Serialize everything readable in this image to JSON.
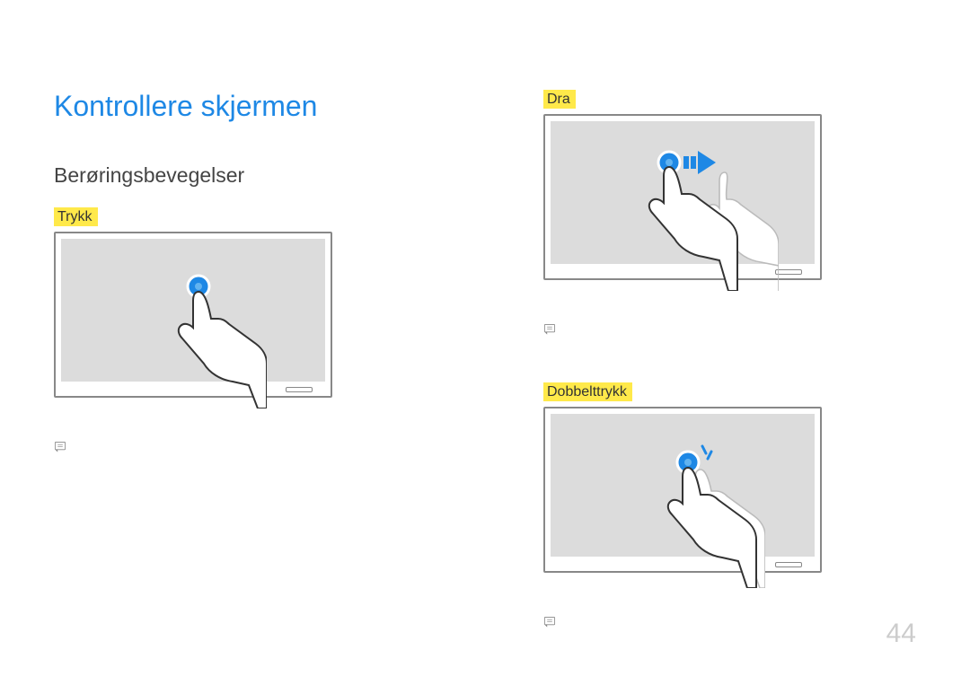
{
  "page_number": "44",
  "title": "Kontrollere skjermen",
  "subtitle": "Berøringsbevegelser",
  "gestures": {
    "tap": {
      "label": "Trykk"
    },
    "drag": {
      "label": "Dra"
    },
    "doubletap": {
      "label": "Dobbelttrykk"
    }
  },
  "colors": {
    "title": "#1e88e5",
    "highlight": "#ffe94a",
    "touch_dot": "#1e88e5",
    "pagenum": "#cccccc"
  }
}
